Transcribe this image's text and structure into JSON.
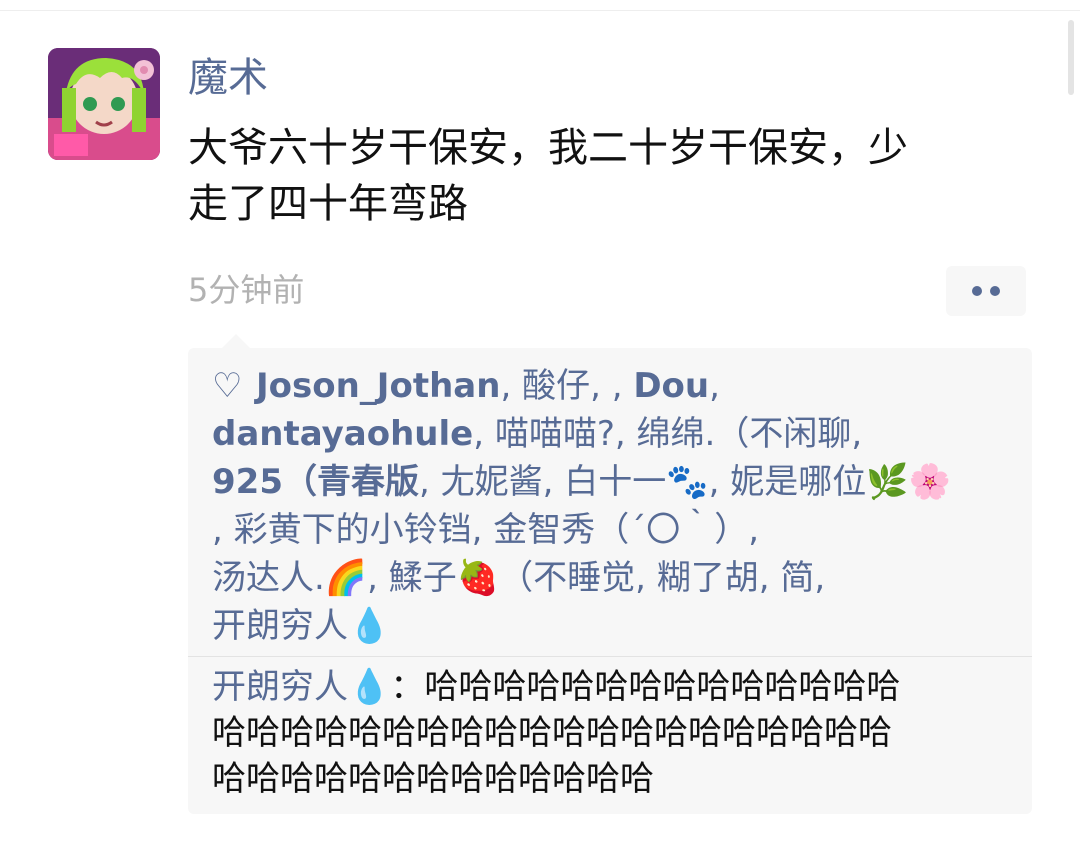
{
  "post": {
    "author": "魔术",
    "text_line1": "大爷六十岁干保安，我二十岁干保安，少",
    "text_line2": "走了四十年弯路",
    "time": "5分钟前"
  },
  "icons": {
    "like": "heart-outline-icon",
    "more": "more-dots-icon"
  },
  "likes": {
    "heart_glyph": "♡",
    "names": [
      "Joson_Jothan",
      "酸仔",
      "",
      "Dou",
      "dantayaohule",
      "喵喵喵?",
      "绵绵.（不闲聊",
      "925（青春版",
      "尢妮酱",
      "白十一🐾",
      "妮是哪位🌿🌸",
      "彩黄下的小铃铛",
      "金智秀（´〇｀）",
      "汤达人.🌈",
      "鰇子🍓（不睡觉",
      "糊了胡",
      "简",
      "开朗穷人💧"
    ]
  },
  "comments": [
    {
      "author": "开朗穷人💧",
      "separator": "：",
      "text_line1": "哈哈哈哈哈哈哈哈哈哈哈哈哈哈",
      "text_line2": "哈哈哈哈哈哈哈哈哈哈哈哈哈哈哈哈哈哈哈哈",
      "text_line3": "哈哈哈哈哈哈哈哈哈哈哈哈哈"
    }
  ],
  "colors": {
    "name_link": "#576b95",
    "text": "#111111",
    "time": "#b2b2b2",
    "panel_bg": "#f7f7f7"
  }
}
